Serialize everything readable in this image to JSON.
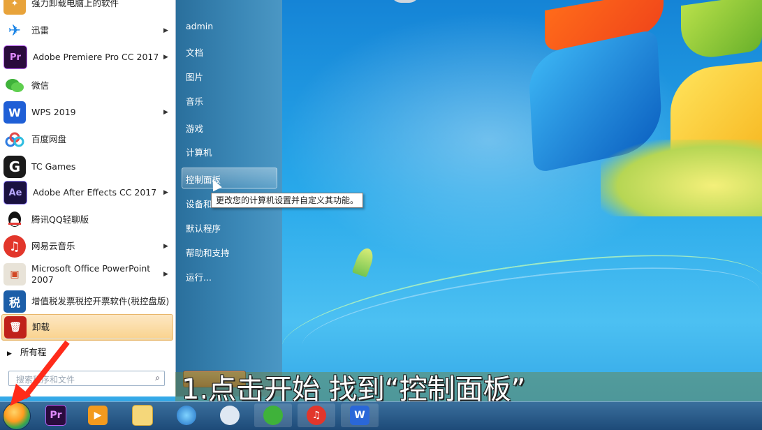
{
  "start_menu": {
    "apps": [
      {
        "label": "强力卸载电脑上的软件",
        "icon": "uninstaller-icon",
        "arrow": false
      },
      {
        "label": "迅雷",
        "icon": "xunlei-icon",
        "arrow": true
      },
      {
        "label": "Adobe Premiere Pro CC 2017",
        "icon": "premiere-icon",
        "icon_text": "Pr",
        "arrow": true
      },
      {
        "label": "微信",
        "icon": "wechat-icon",
        "arrow": false
      },
      {
        "label": "WPS 2019",
        "icon": "wps-icon",
        "arrow": true
      },
      {
        "label": "百度网盘",
        "icon": "baidu-netdisk-icon",
        "arrow": false
      },
      {
        "label": "TC Games",
        "icon": "tc-games-icon",
        "icon_text": "G",
        "arrow": false
      },
      {
        "label": "Adobe After Effects CC 2017",
        "icon": "after-effects-icon",
        "icon_text": "Ae",
        "arrow": true
      },
      {
        "label": "腾讯QQ轻聊版",
        "icon": "qq-icon",
        "arrow": false
      },
      {
        "label": "网易云音乐",
        "icon": "netease-music-icon",
        "arrow": true
      },
      {
        "label": "Microsoft Office PowerPoint 2007",
        "icon": "powerpoint-icon",
        "arrow": true
      },
      {
        "label": "增值税发票税控开票软件(税控盘版)",
        "icon": "tax-invoice-icon",
        "icon_text": "税",
        "arrow": false
      },
      {
        "label": "卸载",
        "icon": "uninstall-icon",
        "arrow": false,
        "highlighted": true
      }
    ],
    "all_programs": "所有程",
    "search_placeholder": "搜索程序和文件",
    "places": [
      "admin",
      "文档",
      "图片",
      "音乐",
      "游戏",
      "计算机",
      "控制面板",
      "设备和",
      "默认程序",
      "帮助和支持",
      "运行..."
    ],
    "tooltip": "更改您的计算机设置并自定义其功能。"
  },
  "caption": "1.点击开始 找到“控制面板”",
  "taskbar": {
    "items": [
      "start-orb",
      "premiere",
      "media-player",
      "explorer",
      "browser",
      "baidu-netdisk",
      "wechat",
      "netease-music",
      "wps"
    ],
    "premiere_text": "Pr"
  },
  "colors": {
    "highlight": "#f9d28c",
    "arrow": "#ff2b1a",
    "right_pane": "#3b88b7"
  }
}
